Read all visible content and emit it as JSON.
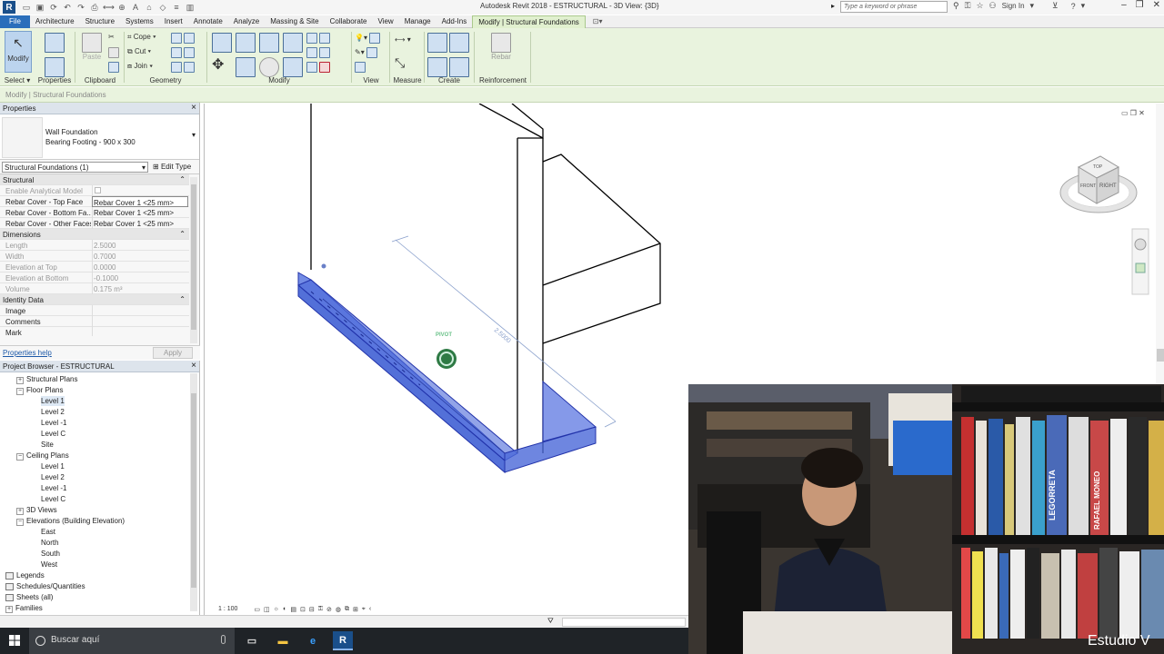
{
  "titlebar": {
    "app_logo": "R",
    "window_title": "Autodesk Revit 2018 -     ESTRUCTURAL - 3D View: {3D}",
    "search_placeholder": "Type a keyword or phrase",
    "sign_in": "Sign In"
  },
  "tabs": [
    "File",
    "Architecture",
    "Structure",
    "Systems",
    "Insert",
    "Annotate",
    "Analyze",
    "Massing & Site",
    "Collaborate",
    "View",
    "Manage",
    "Add-Ins",
    "Modify | Structural Foundations"
  ],
  "ribbon": {
    "modify_label": "Modify",
    "select_label": "Select",
    "properties_label": "Properties",
    "paste_label": "Paste",
    "clipboard_label": "Clipboard",
    "cope_label": "Cope",
    "cut_label": "Cut",
    "join_label": "Join",
    "geometry_label": "Geometry",
    "modify_group_label": "Modify",
    "view_label": "View",
    "measure_label": "Measure",
    "create_label": "Create",
    "rebar_label": "Rebar",
    "reinforcement_label": "Reinforcement"
  },
  "context_bar": "Modify | Structural Foundations",
  "properties": {
    "title": "Properties",
    "type_family": "Wall Foundation",
    "type_name": "Bearing Footing - 900 x 300",
    "filter": "Structural Foundations (1)",
    "edit_type": "Edit Type",
    "rows": [
      {
        "k": "Structural",
        "cat": true
      },
      {
        "k": "Enable Analytical Model",
        "v": "",
        "dim": true
      },
      {
        "k": "Rebar Cover - Top Face",
        "v": "Rebar Cover 1 <25 mm>",
        "boxed": true
      },
      {
        "k": "Rebar Cover - Bottom Fa...",
        "v": "Rebar Cover 1 <25 mm>"
      },
      {
        "k": "Rebar Cover - Other Faces",
        "v": "Rebar Cover 1 <25 mm>"
      },
      {
        "k": "Dimensions",
        "cat": true
      },
      {
        "k": "Length",
        "v": "2.5000",
        "dim": true
      },
      {
        "k": "Width",
        "v": "0.7000",
        "dim": true
      },
      {
        "k": "Elevation at Top",
        "v": "0.0000",
        "dim": true
      },
      {
        "k": "Elevation at Bottom",
        "v": "-0.1000",
        "dim": true
      },
      {
        "k": "Volume",
        "v": "0.175 m³",
        "dim": true
      },
      {
        "k": "Identity Data",
        "cat": true
      },
      {
        "k": "Image",
        "v": ""
      },
      {
        "k": "Comments",
        "v": ""
      },
      {
        "k": "Mark",
        "v": ""
      }
    ],
    "help": "Properties help",
    "apply": "Apply"
  },
  "browser": {
    "title": "Project Browser - ESTRUCTURAL",
    "items": [
      {
        "label": "Structural Plans",
        "exp": "+"
      },
      {
        "label": "Floor Plans",
        "exp": "−"
      },
      {
        "label": "Level 1",
        "sel": true
      },
      {
        "label": "Level 2"
      },
      {
        "label": "Level -1"
      },
      {
        "label": "Level C"
      },
      {
        "label": "Site"
      },
      {
        "label": "Ceiling Plans",
        "exp": "−"
      },
      {
        "label": "Level 1"
      },
      {
        "label": "Level 2"
      },
      {
        "label": "Level -1"
      },
      {
        "label": "Level C"
      },
      {
        "label": "3D Views",
        "exp": "+"
      },
      {
        "label": "Elevations (Building Elevation)",
        "exp": "−"
      },
      {
        "label": "East"
      },
      {
        "label": "North"
      },
      {
        "label": "South"
      },
      {
        "label": "West"
      },
      {
        "label": "Legends",
        "icon": true
      },
      {
        "label": "Schedules/Quantities",
        "icon": true
      },
      {
        "label": "Sheets (all)",
        "icon": true
      },
      {
        "label": "Families",
        "exp": "+"
      }
    ]
  },
  "viewport": {
    "pivot_label": "PIVOT",
    "dimension_value": "2.5000",
    "viewcube_top": "TOP",
    "viewcube_front": "FRONT",
    "viewcube_right": "RIGHT",
    "scale": "1 : 100"
  },
  "taskbar": {
    "search_text": "Buscar aquí"
  },
  "webcam": {
    "label": "Estudio V",
    "book_spine_1": "LEGORRETA",
    "book_spine_2": "RAFAEL MONEO"
  }
}
